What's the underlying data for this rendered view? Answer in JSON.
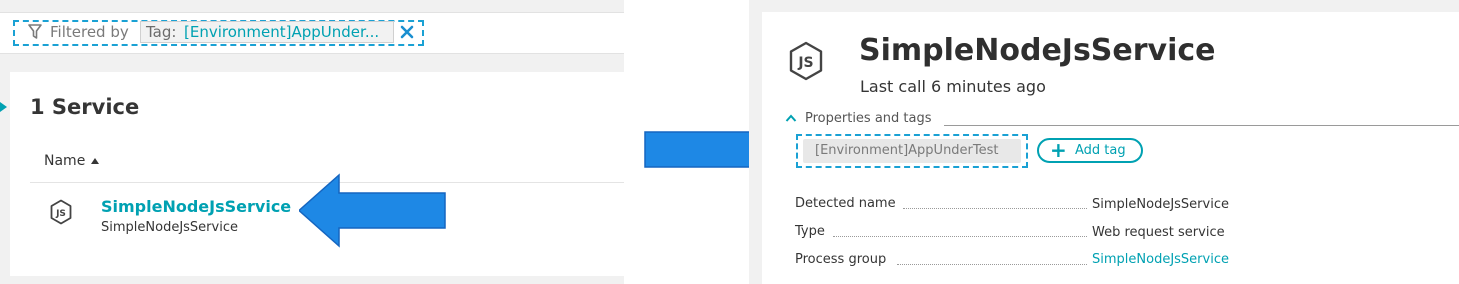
{
  "filter": {
    "label": "Filtered by",
    "tag_key": "Tag:",
    "tag_value": "[Environment]AppUnder..."
  },
  "services": {
    "count_label": "1 Service",
    "name_header": "Name",
    "rows": [
      {
        "name": "SimpleNodeJsService",
        "subtitle": "SimpleNodeJsService"
      }
    ]
  },
  "detail": {
    "title": "SimpleNodeJsService",
    "last_call": "Last call 6 minutes ago",
    "properties_label": "Properties and tags",
    "tag": "[Environment]AppUnderTest",
    "add_tag_label": "Add tag",
    "properties": [
      {
        "label": "Detected name",
        "value": "SimpleNodeJsService"
      },
      {
        "label": "Type",
        "value": "Web request service"
      },
      {
        "label": "Process group",
        "value": "SimpleNodeJsService"
      }
    ]
  },
  "colors": {
    "accent": "#00a1b2",
    "highlight_dashed": "#1aa1d4",
    "arrow": "#1e88e5"
  },
  "icons": [
    "filter-icon",
    "close-icon",
    "nodejs-icon",
    "sort-ascending-icon",
    "chevron-up-icon",
    "plus-icon",
    "arrow-left-icon",
    "arrow-right-icon"
  ]
}
